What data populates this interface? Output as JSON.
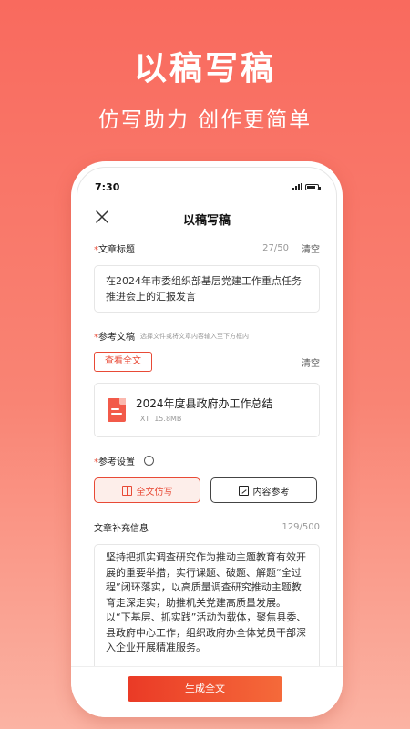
{
  "promo": {
    "headline": "以稿写稿",
    "subline": "仿写助力 创作更简单"
  },
  "status_bar": {
    "time": "7:30"
  },
  "nav": {
    "title": "以稿写稿"
  },
  "article_title": {
    "required_mark": "*",
    "label": "文章标题",
    "counter": "27/50",
    "clear_label": "清空",
    "value": "在2024年市委组织部基层党建工作重点任务推进会上的汇报发言"
  },
  "reference_doc": {
    "required_mark": "*",
    "label": "参考文稿",
    "hint": "选择文件或将文章内容输入至下方框内",
    "view_full_label": "查看全文",
    "clear_label": "清空",
    "file": {
      "name": "2024年度县政府办工作总结",
      "type": "TXT",
      "size": "15.8MB"
    }
  },
  "reference_settings": {
    "required_mark": "*",
    "label": "参考设置",
    "info_glyph": "i",
    "options": [
      {
        "label": "全文仿写",
        "selected": true
      },
      {
        "label": "内容参考",
        "selected": false
      }
    ]
  },
  "supplement": {
    "label": "文章补充信息",
    "counter": "129/500",
    "value": "坚持把抓实调查研究作为推动主题教育有效开展的重要举措，实行课题、破题、解题“全过程”闭环落实，以高质量调查研究推动主题教育走深走实，助推机关党建高质量发展。以“下基层、抓实践”活动为载体，聚焦县委、县政府中心工作，组织政府办全体党员干部深入企业开展精准服务。"
  },
  "actions": {
    "generate_label": "生成全文"
  },
  "colors": {
    "accent": "#e84a36",
    "bg_top": "#f96a5e",
    "bg_bottom": "#fbb3a3"
  }
}
